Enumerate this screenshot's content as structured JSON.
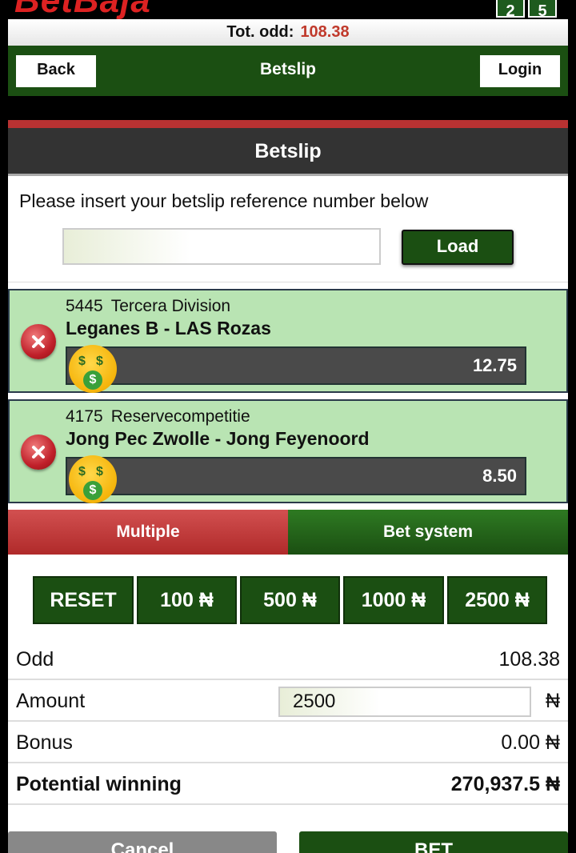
{
  "header": {
    "logo_text": "BetBaja",
    "badges": [
      "2",
      "5"
    ]
  },
  "total_odd": {
    "label": "Tot. odd:",
    "value": "108.38"
  },
  "nav": {
    "back_label": "Back",
    "title": "Betslip",
    "login_label": "Login"
  },
  "betslip": {
    "title": "Betslip",
    "instruction": "Please insert your betslip reference number below",
    "reference_value": "",
    "load_label": "Load"
  },
  "matches": [
    {
      "code": "5445",
      "league": "Tercera Division",
      "teams": "Leganes B - LAS Rozas",
      "odd": "12.75"
    },
    {
      "code": "4175",
      "league": "Reservecompetitie",
      "teams": "Jong Pec Zwolle - Jong Feyenoord",
      "odd": "8.50"
    }
  ],
  "bet_tabs": {
    "multiple": "Multiple",
    "system": "Bet system",
    "active": "Multiple"
  },
  "quick_amounts": [
    "RESET",
    "100 ₦",
    "500 ₦",
    "1000 ₦",
    "2500 ₦"
  ],
  "summary": {
    "odd_label": "Odd",
    "odd_value": "108.38",
    "amount_label": "Amount",
    "amount_value": "2500",
    "currency": "₦",
    "bonus_label": "Bonus",
    "bonus_value": "0.00 ₦",
    "potential_label": "Potential winning",
    "potential_value": "270,937.5 ₦"
  },
  "actions": {
    "cancel_label": "Cancel",
    "bet_label": "BET"
  },
  "colors": {
    "brand_green": "#1b4f12",
    "accent_red": "#b83232",
    "odd_orange": "#c0392b",
    "match_bg": "#b9e4b3"
  }
}
